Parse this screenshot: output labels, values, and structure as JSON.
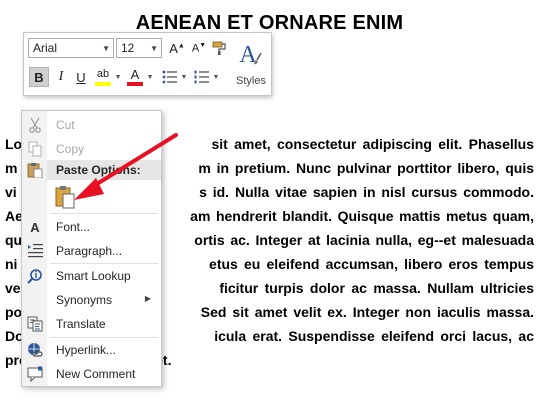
{
  "document": {
    "title": "AENEAN ET ORNARE ENIM",
    "lines": [
      "Lo                              sit amet, consectetur adipiscing elit. Phasellus",
      "m                               m in pretium. Nunc pulvinar porttitor libero, quis",
      "vi                               s id. Nulla vitae sapien in nisl cursus commodo.",
      "Ae                              am hendrerit blandit. Quisque mattis metus quam,",
      "qu                              ortis ac. Integer at lacinia nulla, eg--et malesuada",
      "ni                               etus eu eleifend accumsan, libero eros tempus",
      "ve                               ficitur turpis dolor ac massa. Nullam ultricies",
      "po                              Sed sit amet velit ex. Integer non iaculis massa.",
      "Do                              icula erat. Suspendisse eleifend orci lacus, ac",
      "pretium nulla volutpat et."
    ]
  },
  "mini_toolbar": {
    "font_name": "Arial",
    "font_size": "12",
    "bold_label": "B",
    "italic_label": "I",
    "underline_label": "ab",
    "font_color_label": "A",
    "styles_label": "Styles",
    "styles_glyph": "A",
    "grow_font_label": "A",
    "shrink_font_label": "A"
  },
  "context_menu": {
    "items": [
      {
        "label": "Cut",
        "icon": "scissors-icon",
        "enabled": false
      },
      {
        "label": "Copy",
        "icon": "copy-icon",
        "enabled": false
      },
      {
        "label": "Paste Options:",
        "icon": "clipboard-icon",
        "enabled": true
      },
      {
        "label": "Font...",
        "icon": "font-icon",
        "enabled": true
      },
      {
        "label": "Paragraph...",
        "icon": "paragraph-icon",
        "enabled": true
      },
      {
        "label": "Smart Lookup",
        "icon": "smart-lookup-icon",
        "enabled": true
      },
      {
        "label": "Synonyms",
        "icon": "",
        "enabled": true
      },
      {
        "label": "Translate",
        "icon": "translate-icon",
        "enabled": true
      },
      {
        "label": "Hyperlink...",
        "icon": "hyperlink-icon",
        "enabled": true
      },
      {
        "label": "New Comment",
        "icon": "comment-icon",
        "enabled": true
      }
    ]
  },
  "colors": {
    "highlight_yellow": "#ffff00",
    "font_color_red": "#e81123",
    "annotation_arrow": "#e81123",
    "styles_blue": "#2b579a"
  }
}
